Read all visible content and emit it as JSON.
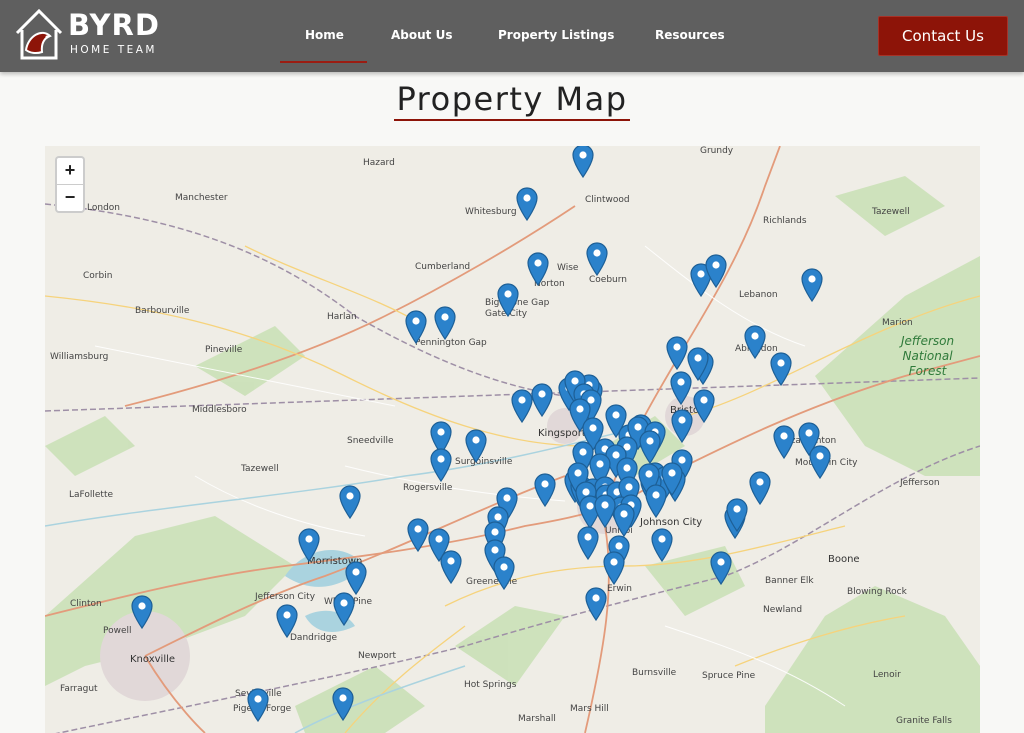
{
  "header": {
    "logo_word": "BYRD",
    "logo_sub": "HOME TEAM",
    "nav": [
      {
        "label": "Home",
        "active": true
      },
      {
        "label": "About Us"
      },
      {
        "label": "Property Listings"
      },
      {
        "label": "Resources"
      }
    ],
    "contact_label": "Contact Us"
  },
  "page_title": "Property Map",
  "map": {
    "zoom_in": "+",
    "zoom_out": "−",
    "park_label": "Jefferson\nNational\nForest",
    "places": [
      "Hazard",
      "Grundy",
      "Manchester",
      "London",
      "Whitesburg",
      "Clintwood",
      "Richlands",
      "Tazewell",
      "Cumberland",
      "Wise",
      "Coeburn",
      "Corbin",
      "Barbourville",
      "Lebanon",
      "Harlan",
      "Marion",
      "Williamsburg",
      "Pineville",
      "Pennington Gap",
      "Big Stone Gap",
      "Abingdon",
      "Middlesboro",
      "Bristol",
      "Kingsport",
      "Sneedville",
      "Surgoinsville",
      "Tazewell",
      "Rogersville",
      "Elizabethton",
      "Jefferson",
      "LaFollette",
      "Johnson City",
      "Morristown",
      "Greeneville",
      "Boone",
      "Jefferson City",
      "White Pine",
      "Banner Elk",
      "Blowing Rock",
      "Clinton",
      "Powell",
      "Dandridge",
      "Erwin",
      "Newland",
      "Knoxville",
      "Newport",
      "Farragut",
      "Hot Springs",
      "Burnsville",
      "Spruce Pine",
      "Lenoir",
      "Sevierville",
      "Pigeon Forge",
      "Mars Hill",
      "Marshall",
      "Granite Falls",
      "Norton",
      "Gate City",
      "Unicoi",
      "Mountain City"
    ],
    "colors": {
      "pin": "#2b82cb",
      "pin_dark": "#1d5f96",
      "accent": "#8d1408"
    }
  }
}
